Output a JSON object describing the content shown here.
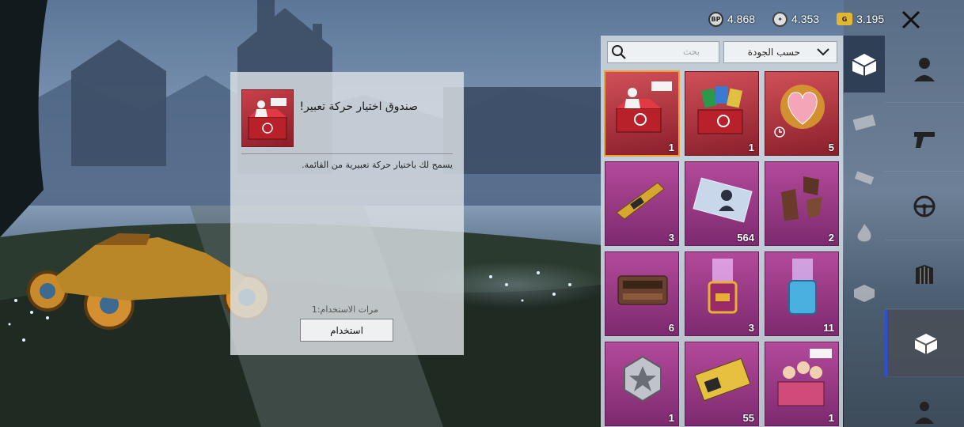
{
  "currencies": [
    {
      "icon": "bp-coin-icon",
      "icon_text": "BP",
      "value": "4.868",
      "color": "#2b2b2b"
    },
    {
      "icon": "silver-fragment-icon",
      "icon_text": "✦",
      "value": "4.353",
      "color": "#3a3a3a"
    },
    {
      "icon": "ag-currency-icon",
      "icon_text": "G",
      "value": "3.195",
      "color": "#c9a22a"
    }
  ],
  "detail": {
    "title": "صندوق اختيار حركة تعبير!",
    "description": "يسمح لك باختيار حركة تعبيرية من القائمة.",
    "uses_label": "مرات الاستخدام:",
    "uses_value": "1",
    "use_button": "استخدام"
  },
  "inventory": {
    "search_placeholder": "بحث",
    "sort_label": "حسب الجودة",
    "items": [
      {
        "name": "emote-crate-item",
        "count": "1",
        "style": "red",
        "selected": true,
        "tag": "",
        "art": "crate"
      },
      {
        "name": "card-crate-item",
        "count": "1",
        "style": "red",
        "selected": false,
        "tag": "",
        "art": "cards"
      },
      {
        "name": "heart-emblem-item",
        "count": "5",
        "style": "red",
        "selected": false,
        "tag": "",
        "art": "heart"
      },
      {
        "name": "gold-gun-upgrade-item",
        "count": "3",
        "style": "purple",
        "selected": false,
        "tag": "",
        "art": "gun"
      },
      {
        "name": "rename-card-item",
        "count": "564",
        "style": "purple",
        "selected": false,
        "tag": "",
        "art": "card"
      },
      {
        "name": "armor-set-item",
        "count": "2",
        "style": "purple",
        "selected": false,
        "tag": "",
        "art": "armor"
      },
      {
        "name": "engine-part-item",
        "count": "6",
        "style": "purple",
        "selected": false,
        "tag": "",
        "art": "engine"
      },
      {
        "name": "glowing-capsule-purple-item",
        "count": "3",
        "style": "purple",
        "selected": false,
        "tag": "",
        "art": "capsule1"
      },
      {
        "name": "glowing-capsule-blue-item",
        "count": "11",
        "style": "purple",
        "selected": false,
        "tag": "",
        "art": "capsule2"
      },
      {
        "name": "silver-badge-item",
        "count": "1",
        "style": "purple",
        "selected": false,
        "tag": "",
        "art": "badge"
      },
      {
        "name": "gold-ticket-item",
        "count": "55",
        "style": "purple",
        "selected": false,
        "tag": "",
        "art": "ticket"
      },
      {
        "name": "character-crate-item",
        "count": "1",
        "style": "purple",
        "selected": false,
        "tag": "",
        "art": "crate2"
      }
    ]
  }
}
